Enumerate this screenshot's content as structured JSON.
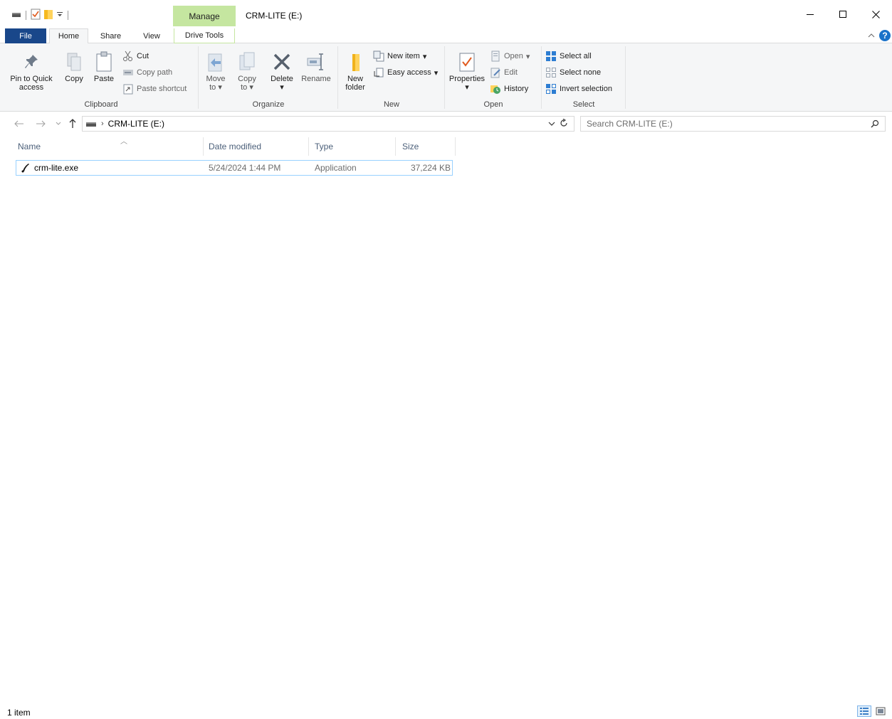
{
  "window": {
    "contextual_tab": "Manage",
    "title": "CRM-LITE (E:)"
  },
  "ribbon_tabs": {
    "file": "File",
    "home": "Home",
    "share": "Share",
    "view": "View",
    "drive_tools": "Drive Tools"
  },
  "clipboard": {
    "label": "Clipboard",
    "pin_line1": "Pin to Quick",
    "pin_line2": "access",
    "copy": "Copy",
    "paste": "Paste",
    "cut": "Cut",
    "copy_path": "Copy path",
    "paste_shortcut": "Paste shortcut"
  },
  "organize": {
    "label": "Organize",
    "move_to_line1": "Move",
    "move_to_line2": "to",
    "copy_to_line1": "Copy",
    "copy_to_line2": "to",
    "delete": "Delete",
    "rename": "Rename"
  },
  "new_group": {
    "label": "New",
    "new_folder_line1": "New",
    "new_folder_line2": "folder",
    "new_item": "New item",
    "easy_access": "Easy access"
  },
  "open_group": {
    "label": "Open",
    "properties": "Properties",
    "open": "Open",
    "edit": "Edit",
    "history": "History"
  },
  "select_group": {
    "label": "Select",
    "select_all": "Select all",
    "select_none": "Select none",
    "invert_selection": "Invert selection"
  },
  "address": {
    "crumb": "CRM-LITE (E:)",
    "search_placeholder": "Search CRM-LITE (E:)"
  },
  "columns": {
    "name": "Name",
    "date_modified": "Date modified",
    "type": "Type",
    "size": "Size"
  },
  "files": [
    {
      "name": "crm-lite.exe",
      "date_modified": "5/24/2024 1:44 PM",
      "type": "Application",
      "size": "37,224 KB"
    }
  ],
  "status": {
    "count": "1 item"
  },
  "colors": {
    "file_tab": "#19478a",
    "manage_tab": "#c5e6a0",
    "selection_border": "#99d1ff",
    "help_icon": "#1a72c9"
  }
}
